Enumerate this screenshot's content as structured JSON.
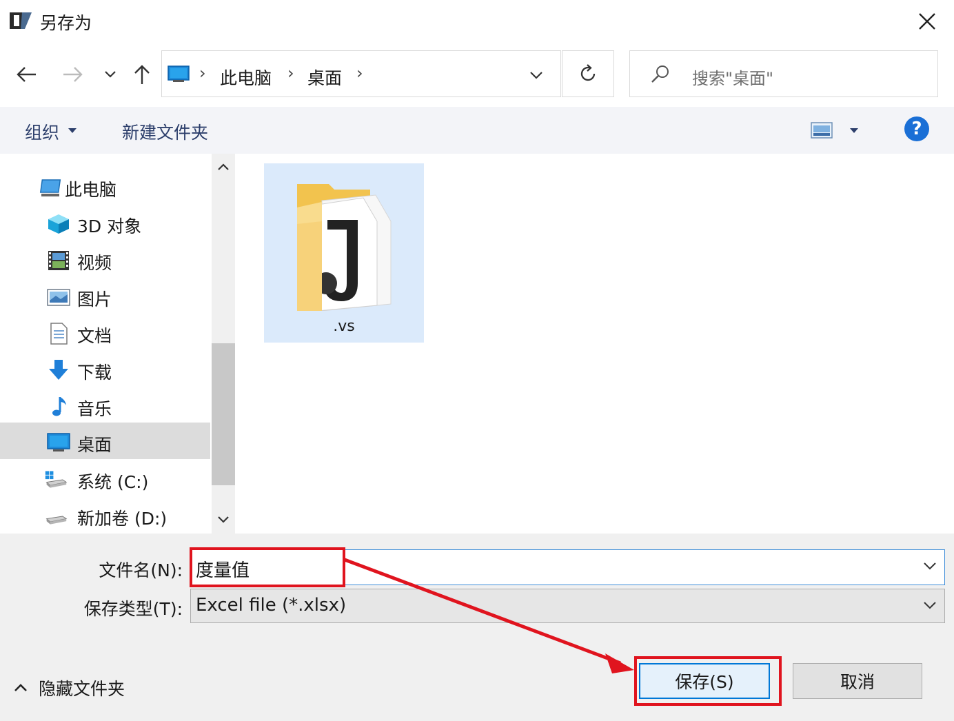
{
  "window": {
    "title": "另存为"
  },
  "address": {
    "crumbs": [
      "此电脑",
      "桌面"
    ]
  },
  "search": {
    "placeholder": "搜索\"桌面\""
  },
  "toolbar": {
    "organize": "组织",
    "new_folder": "新建文件夹",
    "help": "?"
  },
  "sidebar": {
    "items": [
      {
        "label": "此电脑",
        "icon": "computer-icon"
      },
      {
        "label": "3D 对象",
        "icon": "cube-3d-icon"
      },
      {
        "label": "视频",
        "icon": "video-icon"
      },
      {
        "label": "图片",
        "icon": "picture-icon"
      },
      {
        "label": "文档",
        "icon": "document-icon"
      },
      {
        "label": "下载",
        "icon": "download-icon"
      },
      {
        "label": "音乐",
        "icon": "music-icon"
      },
      {
        "label": "桌面",
        "icon": "desktop-icon",
        "selected": true
      },
      {
        "label": "系统 (C:)",
        "icon": "windows-drive-icon"
      },
      {
        "label": "新加卷 (D:)",
        "icon": "drive-icon"
      }
    ]
  },
  "files": [
    {
      "name": ".vs",
      "icon": "folder-icon"
    }
  ],
  "form": {
    "filename_label": "文件名(N):",
    "filename_value": "度量值",
    "filetype_label": "保存类型(T):",
    "filetype_value": "Excel file (*.xlsx)"
  },
  "footer": {
    "hide_folders": "隐藏文件夹",
    "save": "保存(S)",
    "cancel": "取消"
  },
  "colors": {
    "annotation_red": "#e0141e",
    "accent_blue": "#0078d7"
  }
}
